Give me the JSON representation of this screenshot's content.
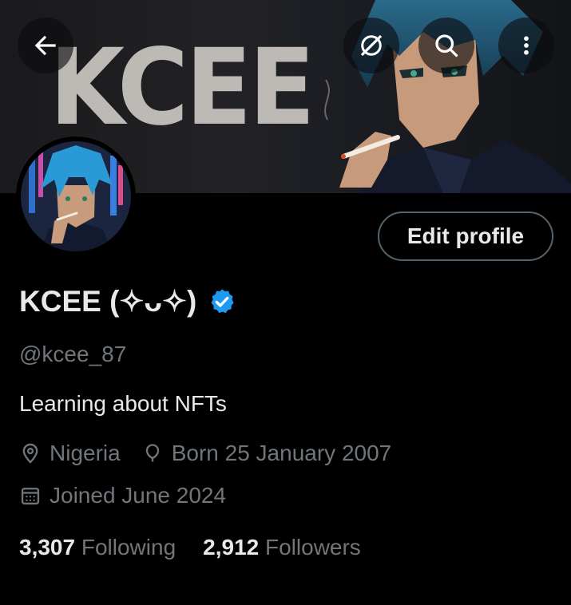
{
  "banner": {
    "text": "KCEE"
  },
  "profile": {
    "display_name": "KCEE (✧ᴗ✧)",
    "handle": "@kcee_87",
    "bio": "Learning about NFTs",
    "location": "Nigeria",
    "birthday": "Born 25 January 2007",
    "joined": "Joined June 2024"
  },
  "actions": {
    "edit_profile": "Edit profile"
  },
  "stats": {
    "following_count": "3,307",
    "following_label": "Following",
    "followers_count": "2,912",
    "followers_label": "Followers"
  },
  "colors": {
    "background": "#000000",
    "verified": "#1d9bf0",
    "muted_text": "#71767b",
    "border": "#536471"
  },
  "icons": [
    "back-arrow-icon",
    "grok-icon",
    "search-icon",
    "more-vertical-icon",
    "verified-badge-icon",
    "location-icon",
    "birthday-icon",
    "calendar-icon"
  ]
}
